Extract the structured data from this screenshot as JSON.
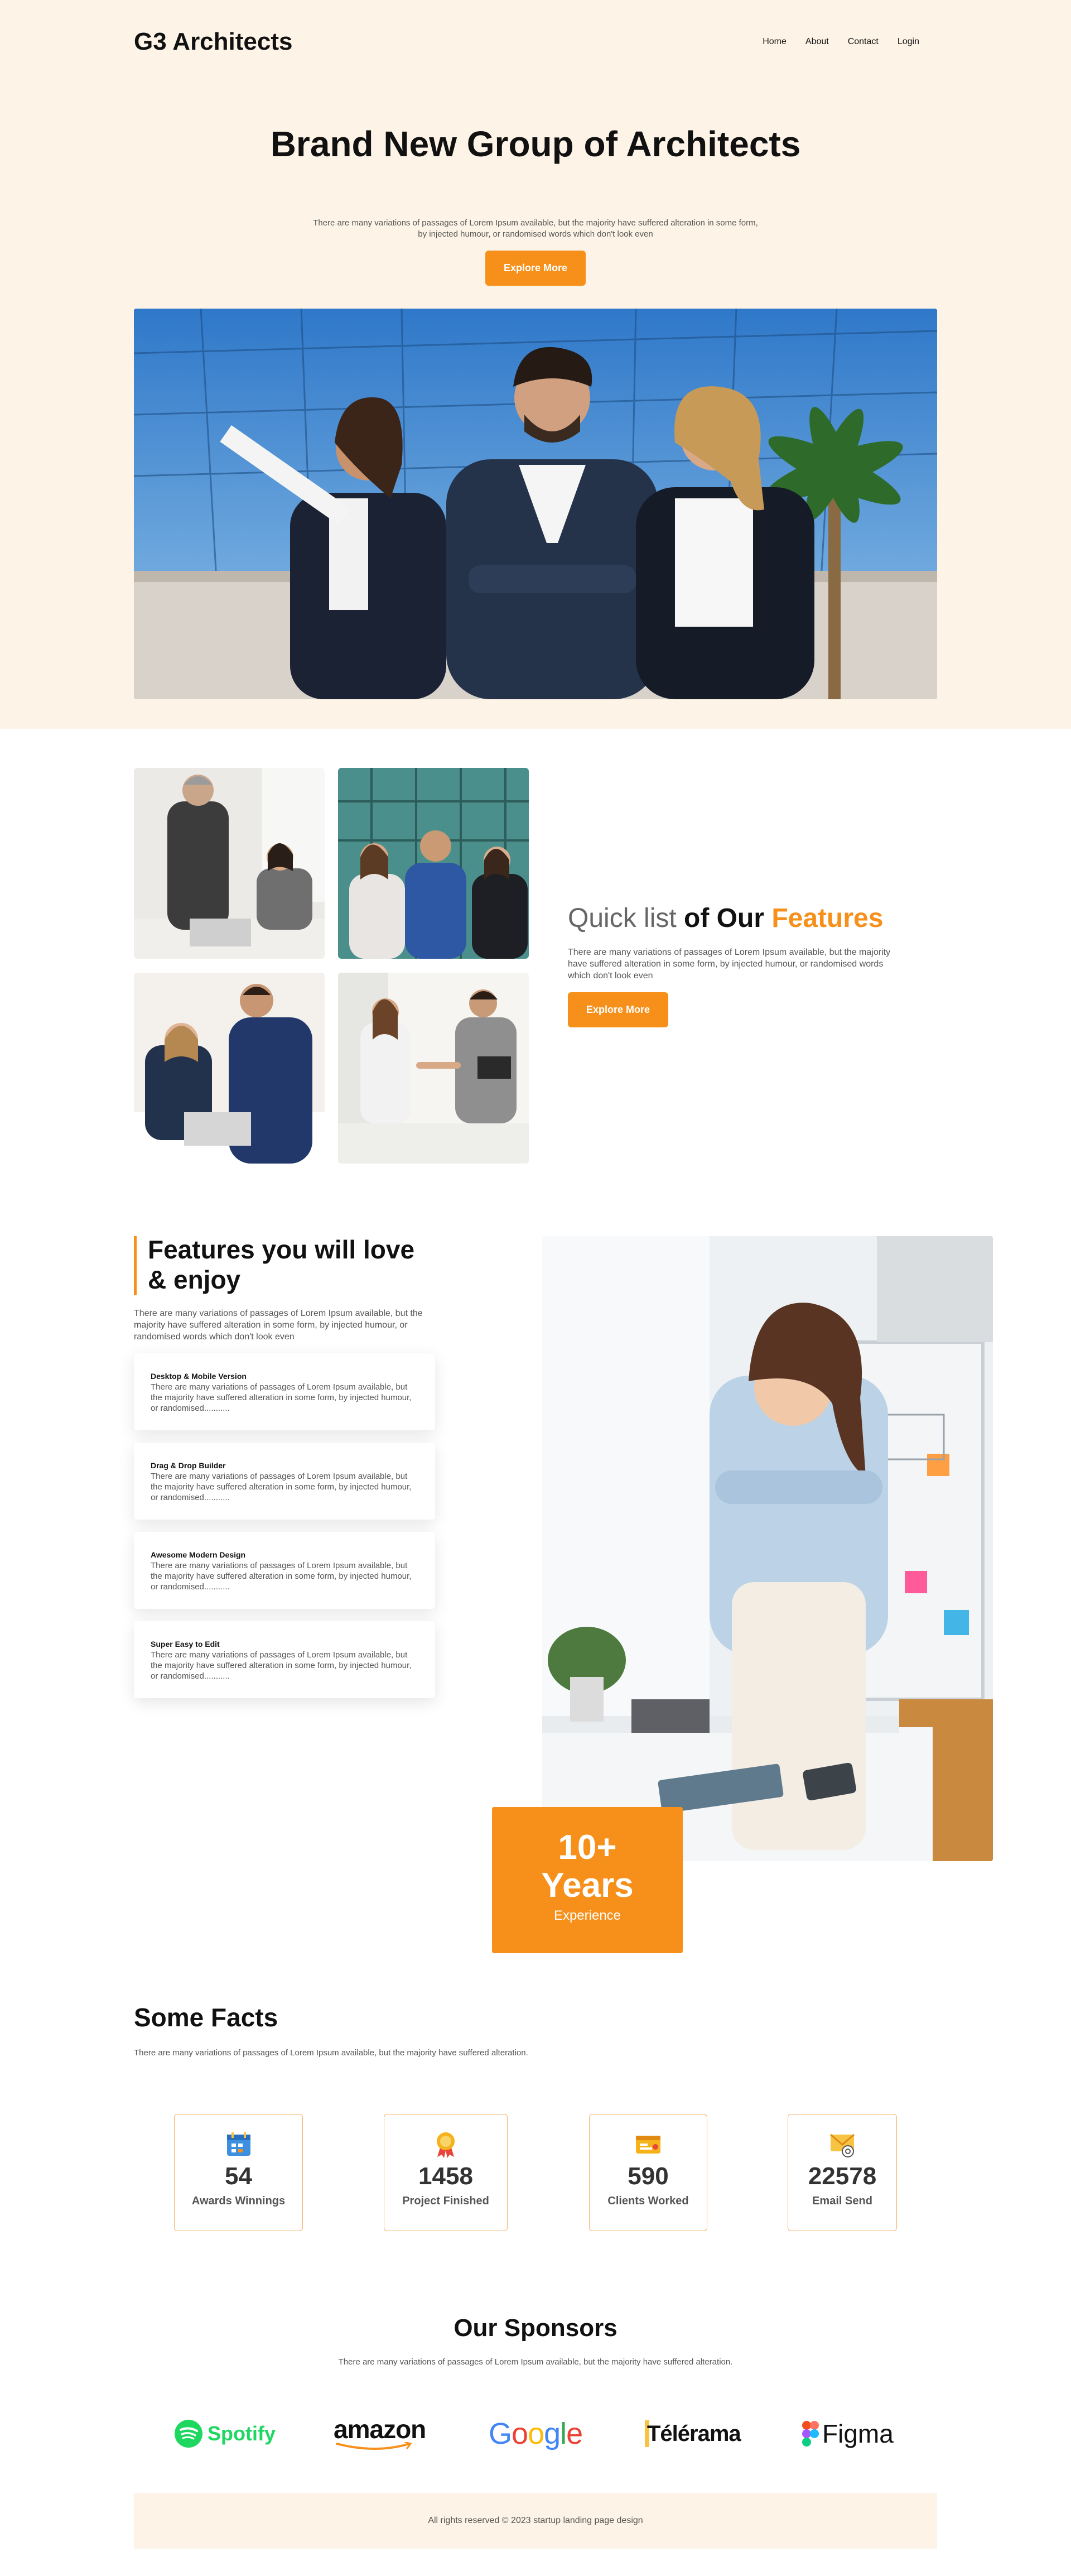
{
  "header": {
    "brand": "G3 Architects",
    "nav": [
      "Home",
      "About",
      "Contact",
      "Login"
    ]
  },
  "hero": {
    "title": "Brand New Group of Architects",
    "subtitle": "There are many variations of passages of Lorem Ipsum available, but the majority have suffered alteration in some form, by injected humour, or randomised words which don't look even",
    "cta": "Explore More"
  },
  "quick_list": {
    "title_part1": "Quick list",
    "title_part2": " of Our ",
    "title_part3": "Features",
    "subtitle": "There are many variations of passages of Lorem Ipsum available, but the majority have suffered alteration in some form, by injected humour, or randomised words which don't look even",
    "cta": "Explore More"
  },
  "features": {
    "title": "Features you will love & enjoy",
    "subtitle": "There are many variations of passages of Lorem Ipsum available, but the majority have suffered alteration in some form, by injected humour, or randomised words which don't look even",
    "items": [
      {
        "title": "Desktop & Mobile Version",
        "text": "There are many variations of passages of Lorem Ipsum available, but the majority have suffered alteration in some form, by injected humour, or randomised..........."
      },
      {
        "title": "Drag & Drop Builder",
        "text": "There are many variations of passages of Lorem Ipsum available, but the majority have suffered alteration in some form, by injected humour, or randomised..........."
      },
      {
        "title": "Awesome Modern Design",
        "text": "There are many variations of passages of Lorem Ipsum available, but the majority have suffered alteration in some form, by injected humour, or randomised..........."
      },
      {
        "title": "Super Easy to Edit",
        "text": "There are many variations of passages of Lorem Ipsum available, but the majority have suffered alteration in some form, by injected humour, or randomised..........."
      }
    ],
    "years_number": "10+",
    "years_word": "Years",
    "years_label": "Experience"
  },
  "facts": {
    "title": "Some Facts",
    "subtitle": "There are many variations of passages of Lorem Ipsum available, but the majority have suffered alteration.",
    "items": [
      {
        "icon": "calendar-icon",
        "number": "54",
        "label": "Awards Winnings"
      },
      {
        "icon": "award-ribbon-icon",
        "number": "1458",
        "label": "Project Finished"
      },
      {
        "icon": "id-card-icon",
        "number": "590",
        "label": "Clients Worked"
      },
      {
        "icon": "email-icon",
        "number": "22578",
        "label": "Email Send"
      }
    ]
  },
  "sponsors": {
    "title": "Our Sponsors",
    "subtitle": "There are many variations of passages of Lorem Ipsum available, but the majority have suffered alteration.",
    "logos": [
      "Spotify",
      "amazon",
      "Google",
      "Télérama",
      "Figma"
    ]
  },
  "footer": {
    "text": "All rights reserved © 2023 startup landing page design"
  },
  "colors": {
    "accent": "#f6901a",
    "hero_bg": "#fdf4e7",
    "spotify": "#1ed760"
  }
}
